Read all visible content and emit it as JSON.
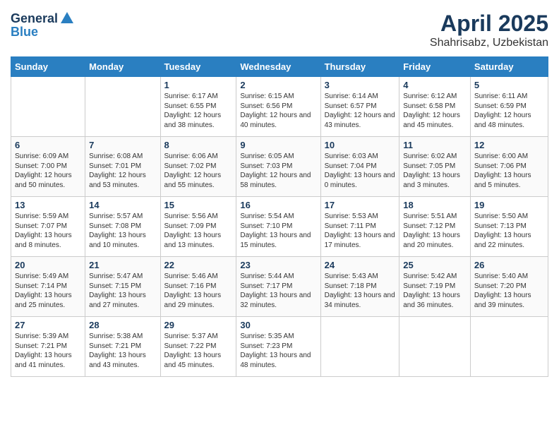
{
  "header": {
    "logo_line1": "General",
    "logo_line2": "Blue",
    "month_year": "April 2025",
    "location": "Shahrisabz, Uzbekistan"
  },
  "days_of_week": [
    "Sunday",
    "Monday",
    "Tuesday",
    "Wednesday",
    "Thursday",
    "Friday",
    "Saturday"
  ],
  "weeks": [
    [
      {
        "day": "",
        "sunrise": "",
        "sunset": "",
        "daylight": ""
      },
      {
        "day": "",
        "sunrise": "",
        "sunset": "",
        "daylight": ""
      },
      {
        "day": "1",
        "sunrise": "Sunrise: 6:17 AM",
        "sunset": "Sunset: 6:55 PM",
        "daylight": "Daylight: 12 hours and 38 minutes."
      },
      {
        "day": "2",
        "sunrise": "Sunrise: 6:15 AM",
        "sunset": "Sunset: 6:56 PM",
        "daylight": "Daylight: 12 hours and 40 minutes."
      },
      {
        "day": "3",
        "sunrise": "Sunrise: 6:14 AM",
        "sunset": "Sunset: 6:57 PM",
        "daylight": "Daylight: 12 hours and 43 minutes."
      },
      {
        "day": "4",
        "sunrise": "Sunrise: 6:12 AM",
        "sunset": "Sunset: 6:58 PM",
        "daylight": "Daylight: 12 hours and 45 minutes."
      },
      {
        "day": "5",
        "sunrise": "Sunrise: 6:11 AM",
        "sunset": "Sunset: 6:59 PM",
        "daylight": "Daylight: 12 hours and 48 minutes."
      }
    ],
    [
      {
        "day": "6",
        "sunrise": "Sunrise: 6:09 AM",
        "sunset": "Sunset: 7:00 PM",
        "daylight": "Daylight: 12 hours and 50 minutes."
      },
      {
        "day": "7",
        "sunrise": "Sunrise: 6:08 AM",
        "sunset": "Sunset: 7:01 PM",
        "daylight": "Daylight: 12 hours and 53 minutes."
      },
      {
        "day": "8",
        "sunrise": "Sunrise: 6:06 AM",
        "sunset": "Sunset: 7:02 PM",
        "daylight": "Daylight: 12 hours and 55 minutes."
      },
      {
        "day": "9",
        "sunrise": "Sunrise: 6:05 AM",
        "sunset": "Sunset: 7:03 PM",
        "daylight": "Daylight: 12 hours and 58 minutes."
      },
      {
        "day": "10",
        "sunrise": "Sunrise: 6:03 AM",
        "sunset": "Sunset: 7:04 PM",
        "daylight": "Daylight: 13 hours and 0 minutes."
      },
      {
        "day": "11",
        "sunrise": "Sunrise: 6:02 AM",
        "sunset": "Sunset: 7:05 PM",
        "daylight": "Daylight: 13 hours and 3 minutes."
      },
      {
        "day": "12",
        "sunrise": "Sunrise: 6:00 AM",
        "sunset": "Sunset: 7:06 PM",
        "daylight": "Daylight: 13 hours and 5 minutes."
      }
    ],
    [
      {
        "day": "13",
        "sunrise": "Sunrise: 5:59 AM",
        "sunset": "Sunset: 7:07 PM",
        "daylight": "Daylight: 13 hours and 8 minutes."
      },
      {
        "day": "14",
        "sunrise": "Sunrise: 5:57 AM",
        "sunset": "Sunset: 7:08 PM",
        "daylight": "Daylight: 13 hours and 10 minutes."
      },
      {
        "day": "15",
        "sunrise": "Sunrise: 5:56 AM",
        "sunset": "Sunset: 7:09 PM",
        "daylight": "Daylight: 13 hours and 13 minutes."
      },
      {
        "day": "16",
        "sunrise": "Sunrise: 5:54 AM",
        "sunset": "Sunset: 7:10 PM",
        "daylight": "Daylight: 13 hours and 15 minutes."
      },
      {
        "day": "17",
        "sunrise": "Sunrise: 5:53 AM",
        "sunset": "Sunset: 7:11 PM",
        "daylight": "Daylight: 13 hours and 17 minutes."
      },
      {
        "day": "18",
        "sunrise": "Sunrise: 5:51 AM",
        "sunset": "Sunset: 7:12 PM",
        "daylight": "Daylight: 13 hours and 20 minutes."
      },
      {
        "day": "19",
        "sunrise": "Sunrise: 5:50 AM",
        "sunset": "Sunset: 7:13 PM",
        "daylight": "Daylight: 13 hours and 22 minutes."
      }
    ],
    [
      {
        "day": "20",
        "sunrise": "Sunrise: 5:49 AM",
        "sunset": "Sunset: 7:14 PM",
        "daylight": "Daylight: 13 hours and 25 minutes."
      },
      {
        "day": "21",
        "sunrise": "Sunrise: 5:47 AM",
        "sunset": "Sunset: 7:15 PM",
        "daylight": "Daylight: 13 hours and 27 minutes."
      },
      {
        "day": "22",
        "sunrise": "Sunrise: 5:46 AM",
        "sunset": "Sunset: 7:16 PM",
        "daylight": "Daylight: 13 hours and 29 minutes."
      },
      {
        "day": "23",
        "sunrise": "Sunrise: 5:44 AM",
        "sunset": "Sunset: 7:17 PM",
        "daylight": "Daylight: 13 hours and 32 minutes."
      },
      {
        "day": "24",
        "sunrise": "Sunrise: 5:43 AM",
        "sunset": "Sunset: 7:18 PM",
        "daylight": "Daylight: 13 hours and 34 minutes."
      },
      {
        "day": "25",
        "sunrise": "Sunrise: 5:42 AM",
        "sunset": "Sunset: 7:19 PM",
        "daylight": "Daylight: 13 hours and 36 minutes."
      },
      {
        "day": "26",
        "sunrise": "Sunrise: 5:40 AM",
        "sunset": "Sunset: 7:20 PM",
        "daylight": "Daylight: 13 hours and 39 minutes."
      }
    ],
    [
      {
        "day": "27",
        "sunrise": "Sunrise: 5:39 AM",
        "sunset": "Sunset: 7:21 PM",
        "daylight": "Daylight: 13 hours and 41 minutes."
      },
      {
        "day": "28",
        "sunrise": "Sunrise: 5:38 AM",
        "sunset": "Sunset: 7:21 PM",
        "daylight": "Daylight: 13 hours and 43 minutes."
      },
      {
        "day": "29",
        "sunrise": "Sunrise: 5:37 AM",
        "sunset": "Sunset: 7:22 PM",
        "daylight": "Daylight: 13 hours and 45 minutes."
      },
      {
        "day": "30",
        "sunrise": "Sunrise: 5:35 AM",
        "sunset": "Sunset: 7:23 PM",
        "daylight": "Daylight: 13 hours and 48 minutes."
      },
      {
        "day": "",
        "sunrise": "",
        "sunset": "",
        "daylight": ""
      },
      {
        "day": "",
        "sunrise": "",
        "sunset": "",
        "daylight": ""
      },
      {
        "day": "",
        "sunrise": "",
        "sunset": "",
        "daylight": ""
      }
    ]
  ]
}
